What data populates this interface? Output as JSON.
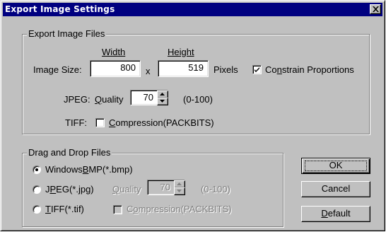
{
  "window": {
    "title": "Export Image Settings",
    "close_icon": "close-x-icon"
  },
  "export_group": {
    "legend": "Export Image Files",
    "width_header": "Width",
    "height_header": "Height",
    "image_size_label": "Image Size:",
    "width_value": "800",
    "times_label": "x",
    "height_value": "519",
    "pixels_label": "Pixels",
    "constrain": {
      "pre": "Co",
      "key": "n",
      "post": "strain Proportions",
      "checked": true
    },
    "jpeg_label": "JPEG:",
    "quality": {
      "key": "Q",
      "post": "uality"
    },
    "quality_value": "70",
    "quality_range": "(0-100)",
    "tiff_label": "TIFF:",
    "compression": {
      "key": "C",
      "post": "ompression(PACKBITS)",
      "checked": false
    }
  },
  "dragdrop_group": {
    "legend": "Drag and Drop Files",
    "bmp": {
      "pre": "Windows",
      "key": "B",
      "post": "MP(*.bmp)",
      "selected": true
    },
    "jpeg": {
      "pre": "J",
      "key": "P",
      "post": "EG(*.jpg)",
      "selected": false
    },
    "tiff": {
      "key": "T",
      "post": "IFF(*.tif)",
      "selected": false
    },
    "quality": {
      "key": "Q",
      "post": "uality"
    },
    "quality_value": "70",
    "quality_range": "(0-100)",
    "compression": {
      "pre": "C",
      "key": "o",
      "post": "mpression(PACKBITS)",
      "checked": false
    }
  },
  "buttons": {
    "ok": "OK",
    "cancel": "Cancel",
    "default": {
      "key": "D",
      "post": "efault"
    }
  }
}
